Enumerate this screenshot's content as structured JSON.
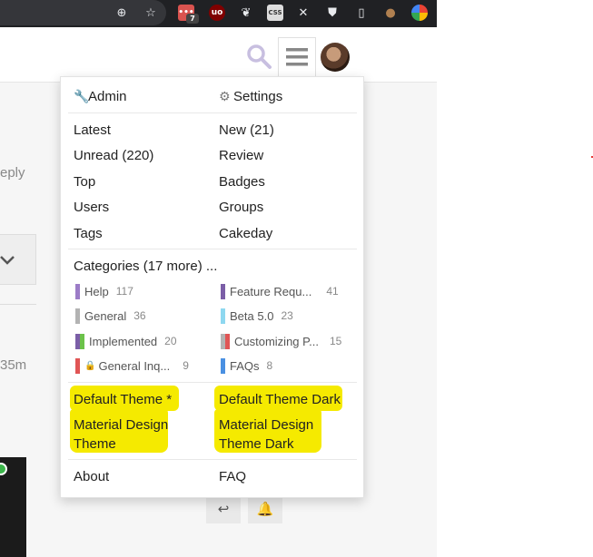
{
  "browser": {
    "toolbar_icons": [
      "add-icon",
      "star-icon",
      "ext-todo-icon",
      "ublock-icon",
      "ext-bird-icon",
      "css-icon",
      "x-icon",
      "ext-shield-icon",
      "document-icon",
      "ext-shell-icon",
      "ext-colors-icon"
    ],
    "ext_badge": "7",
    "css_label": "CSS"
  },
  "background": {
    "reply_fragment": "eply",
    "time_fragment": "35m"
  },
  "menu": {
    "admin": "Admin",
    "settings": "Settings",
    "links": [
      "Latest",
      "New (21)",
      "Unread (220)",
      "Review",
      "Top",
      "Badges",
      "Users",
      "Groups",
      "Tags",
      "Cakeday"
    ],
    "categories_title": "Categories (17 more) ...",
    "categories": [
      {
        "name": "Help",
        "count": "117",
        "colors": [
          "#9c7cc7"
        ]
      },
      {
        "name": "Feature Requ...",
        "count": "41",
        "colors": [
          "#7b5ea7"
        ]
      },
      {
        "name": "General",
        "count": "36",
        "colors": [
          "#b3b3b3"
        ]
      },
      {
        "name": "Beta 5.0",
        "count": "23",
        "colors": [
          "#8ed8f0"
        ]
      },
      {
        "name": "Implemented",
        "count": "20",
        "colors": [
          "#7b5ea7",
          "#6cc24a"
        ]
      },
      {
        "name": "Customizing P...",
        "count": "15",
        "colors": [
          "#b3b3b3",
          "#e05555"
        ]
      },
      {
        "name": "General Inq...",
        "count": "9",
        "colors": [
          "#e05555"
        ],
        "locked": true
      },
      {
        "name": "FAQs",
        "count": "8",
        "colors": [
          "#4a90e2"
        ]
      }
    ],
    "themes": [
      "Default Theme *",
      "Default Theme Dark",
      "Material Design Theme",
      "Material Design Theme Dark"
    ],
    "footer": [
      "About",
      "FAQ"
    ]
  },
  "colors": {
    "highlight": "#f5ea00",
    "chrome_dark": "#202124"
  }
}
